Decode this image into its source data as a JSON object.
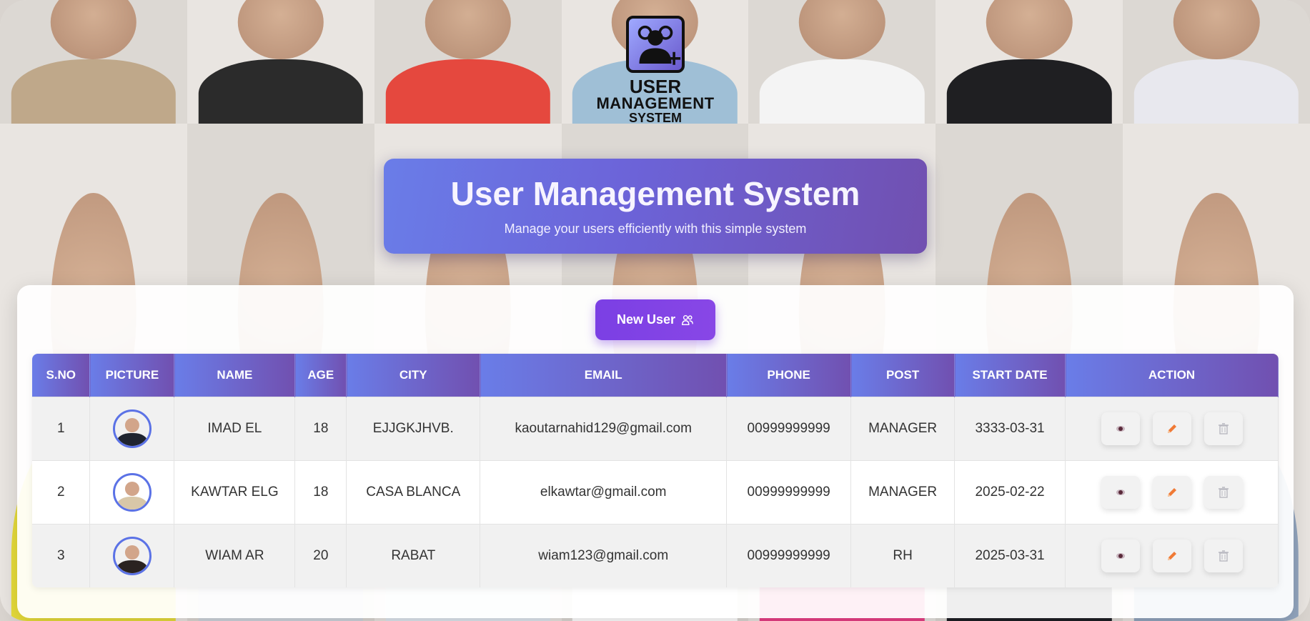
{
  "background": {
    "tiles": [
      {
        "shirt": "#bfa88a"
      },
      {
        "shirt": "#2b2b2b"
      },
      {
        "shirt": "#e5483e"
      },
      {
        "shirt": "#9fbfd6"
      },
      {
        "shirt": "#f4f4f4"
      },
      {
        "shirt": "#1f1f22"
      },
      {
        "shirt": "#e8e8ee"
      },
      {
        "shirt": "#e7dc3a"
      },
      {
        "shirt": "#cfd5dd"
      },
      {
        "shirt": "#dfe7ef"
      },
      {
        "shirt": "#ffffff"
      },
      {
        "shirt": "#ea3f86"
      },
      {
        "shirt": "#1d1e24"
      },
      {
        "shirt": "#93a6bf"
      }
    ]
  },
  "logo": {
    "line1": "USER",
    "line2": "MANAGEMENT",
    "line3": "SYSTEM"
  },
  "hero": {
    "title": "User Management System",
    "subtitle": "Manage your users efficiently with this simple system"
  },
  "toolbar": {
    "new_user_label": "New User"
  },
  "table": {
    "headers": [
      "S.NO",
      "PICTURE",
      "NAME",
      "AGE",
      "CITY",
      "EMAIL",
      "PHONE",
      "POST",
      "START DATE",
      "ACTION"
    ],
    "rows": [
      {
        "sno": "1",
        "name": "IMAD EL",
        "age": "18",
        "city": "EJJGKJHVB.",
        "email": "kaoutarnahid129@gmail.com",
        "phone": "00999999999",
        "post": "MANAGER",
        "start_date": "3333-03-31",
        "avatar_suit": "#1f2430"
      },
      {
        "sno": "2",
        "name": "KAWTAR ELG",
        "age": "18",
        "city": "CASA BLANCA",
        "email": "elkawtar@gmail.com",
        "phone": "00999999999",
        "post": "MANAGER",
        "start_date": "2025-02-22",
        "avatar_suit": "#d8c7a8"
      },
      {
        "sno": "3",
        "name": "WIAM AR",
        "age": "20",
        "city": "RABAT",
        "email": "wiam123@gmail.com",
        "phone": "00999999999",
        "post": "RH",
        "start_date": "2025-03-31",
        "avatar_suit": "#2a2220"
      }
    ]
  },
  "icons": {
    "view": "eye-icon",
    "edit": "pencil-icon",
    "delete": "trash-icon",
    "new_user": "users-icon"
  },
  "colors": {
    "header_gradient_start": "#6a7de8",
    "header_gradient_end": "#7150b0",
    "button_purple": "#7b3fe4",
    "edit_orange": "#f07a36",
    "view_dark": "#5a2a3a"
  }
}
